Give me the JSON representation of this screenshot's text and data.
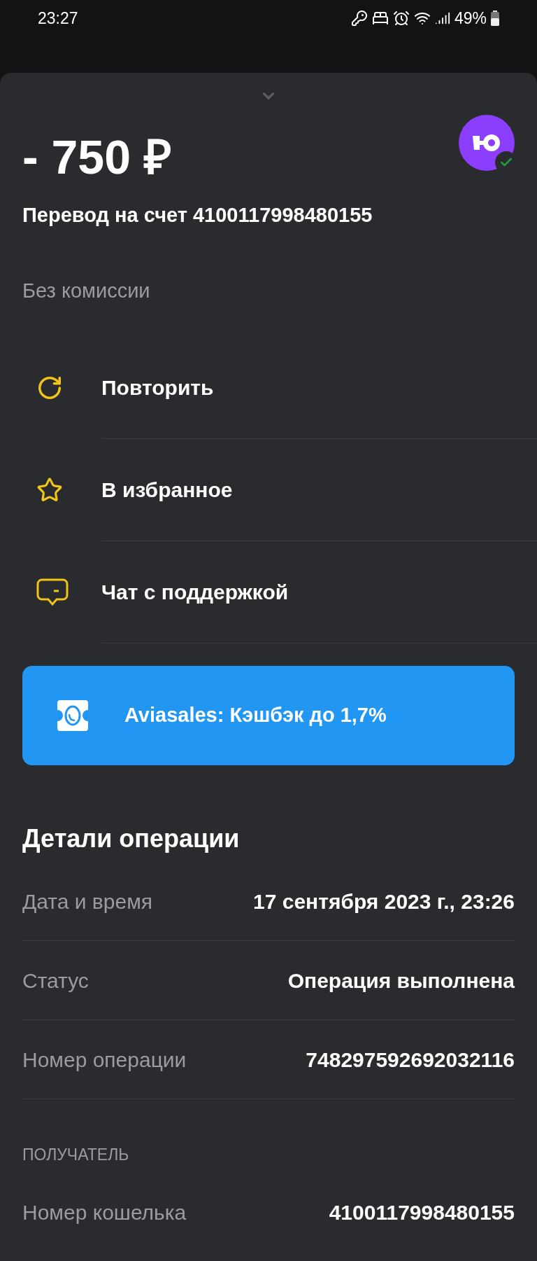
{
  "status_bar": {
    "time": "23:27",
    "battery": "49%"
  },
  "operation": {
    "amount": "- 750 ₽",
    "description": "Перевод на счет 4100117998480155",
    "verified": true,
    "fee": "Без комиссии"
  },
  "actions": [
    {
      "kind": "repeat",
      "label": "Повторить"
    },
    {
      "kind": "favorite",
      "label": "В избранное"
    },
    {
      "kind": "chat",
      "label": "Чат с поддержкой"
    }
  ],
  "promo": {
    "text": "Aviasales: Кэшбэк до 1,7%"
  },
  "details": {
    "title": "Детали операции",
    "rows": [
      {
        "label": "Дата и время",
        "value": "17 сентября 2023 г., 23:26"
      },
      {
        "label": "Статус",
        "value": "Операция выполнена"
      },
      {
        "label": "Номер операции",
        "value": "748297592692032116"
      }
    ]
  },
  "recipient": {
    "heading": "ПОЛУЧАТЕЛЬ",
    "rows": [
      {
        "label": "Номер кошелька",
        "value": "4100117998480155"
      }
    ]
  }
}
